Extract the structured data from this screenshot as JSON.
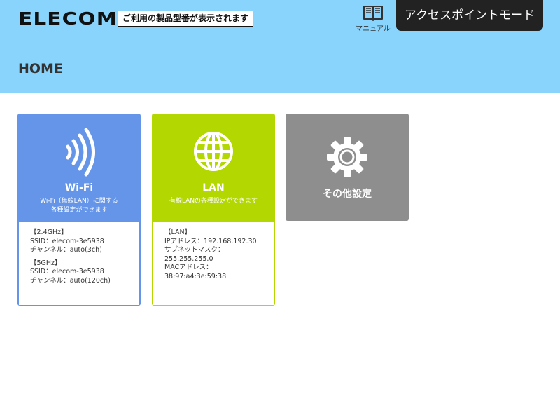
{
  "header": {
    "logo": "ELECOM",
    "model_notice": "ご利用の製品型番が表示されます",
    "manual_label": "マニュアル",
    "mode_button": "アクセスポイントモード",
    "page_title": "HOME"
  },
  "cards": {
    "wifi": {
      "title": "Wi-Fi",
      "desc_line1": "Wi-Fi（無線LAN）に関する",
      "desc_line2": "各種設定ができます",
      "band24": {
        "heading": "【2.4GHz】",
        "ssid": "SSID：elecom-3e5938",
        "channel": "チャンネル：auto(3ch)"
      },
      "band5": {
        "heading": "【5GHz】",
        "ssid": "SSID：elecom-3e5938",
        "channel": "チャンネル：auto(120ch)"
      }
    },
    "lan": {
      "title": "LAN",
      "desc": "有線LANの各種設定ができます",
      "heading": "【LAN】",
      "ip": "IPアドレス：192.168.192.30",
      "subnet_label": "サブネットマスク：",
      "subnet_value": "255.255.255.0",
      "mac_label": "MACアドレス：",
      "mac_value": "38:97:a4:3e:59:38"
    },
    "other": {
      "title": "その他設定"
    }
  },
  "colors": {
    "header_bg": "#88d4fc",
    "wifi": "#6495e8",
    "lan": "#b3d700",
    "other": "#8e8e8e",
    "mode_button_bg": "#222222"
  },
  "icons": [
    "book-icon",
    "wifi-signal-icon",
    "globe-icon",
    "gear-icon"
  ]
}
